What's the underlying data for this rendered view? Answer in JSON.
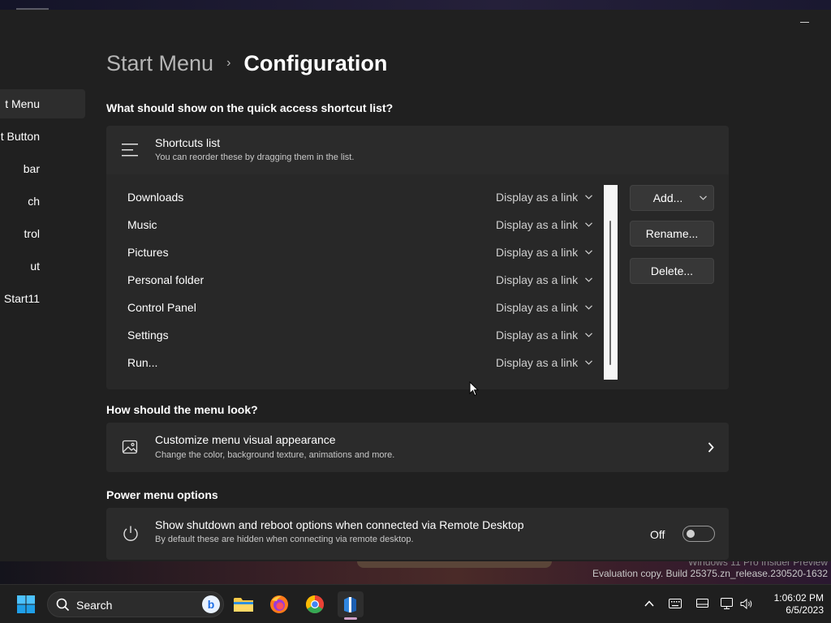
{
  "breadcrumb": {
    "parent": "Start Menu",
    "separator": "›",
    "current": "Configuration"
  },
  "sidebar": {
    "items": [
      {
        "label": "t Menu",
        "active": true
      },
      {
        "label": "t Button",
        "active": false
      },
      {
        "label": "bar",
        "active": false
      },
      {
        "label": "ch",
        "active": false
      },
      {
        "label": "trol",
        "active": false
      },
      {
        "label": "ut",
        "active": false
      },
      {
        "label": "Start11",
        "active": false
      }
    ]
  },
  "quick_access": {
    "heading": "What should show on the quick access shortcut list?",
    "card_title": "Shortcuts list",
    "card_subtitle": "You can reorder these by dragging them in the list.",
    "rows": [
      {
        "name": "Downloads",
        "mode": "Display as a link"
      },
      {
        "name": "Music",
        "mode": "Display as a link"
      },
      {
        "name": "Pictures",
        "mode": "Display as a link"
      },
      {
        "name": "Personal folder",
        "mode": "Display as a link"
      },
      {
        "name": "Control Panel",
        "mode": "Display as a link"
      },
      {
        "name": "Settings",
        "mode": "Display as a link"
      },
      {
        "name": "Run...",
        "mode": "Display as a link"
      }
    ],
    "buttons": {
      "add": "Add...",
      "rename": "Rename...",
      "delete": "Delete..."
    }
  },
  "look": {
    "heading": "How should the menu look?",
    "title": "Customize menu visual appearance",
    "subtitle": "Change the color, background texture, animations and more."
  },
  "power": {
    "heading": "Power menu options",
    "title": "Show shutdown and reboot options when connected via Remote Desktop",
    "subtitle": "By default these are hidden when connecting via remote desktop.",
    "toggle_label": "Off",
    "toggle_on": false
  },
  "watermark": {
    "line1": "Windows 11 Pro Insider Preview",
    "line2": "Evaluation copy. Build 25375.zn_release.230520-1632"
  },
  "taskbar": {
    "search_label": "Search",
    "bing_label": "b",
    "time": "1:06:02 PM",
    "date": "6/5/2023",
    "apps": [
      "windows-start",
      "search",
      "file-explorer",
      "firefox",
      "chrome",
      "start11"
    ]
  },
  "colors": {
    "window_bg": "#202020",
    "card_bg": "#2b2b2b",
    "accent_indicator": "#cfa0c8"
  }
}
